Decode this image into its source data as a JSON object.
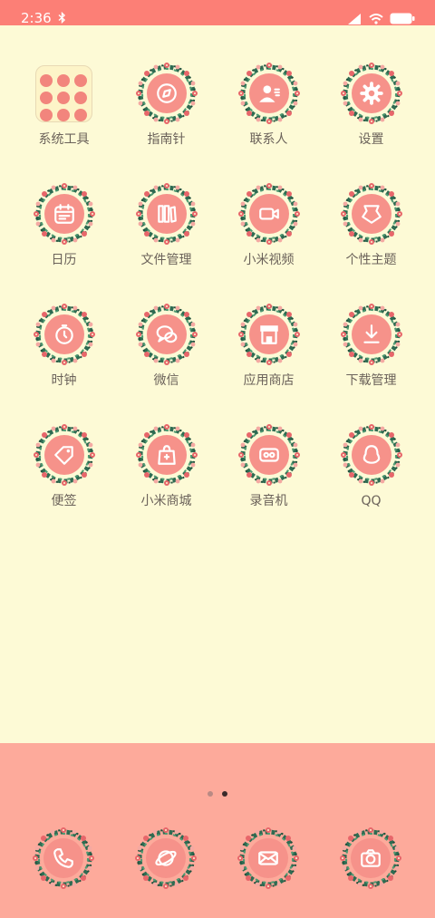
{
  "status_bar": {
    "time": "2:36",
    "bluetooth_icon": "bluetooth-icon",
    "signal_icon": "signal-icon",
    "wifi_icon": "wifi-icon",
    "battery_icon": "battery-icon"
  },
  "apps": [
    {
      "label": "系统工具",
      "icon": "folder-icon"
    },
    {
      "label": "指南针",
      "icon": "compass-icon"
    },
    {
      "label": "联系人",
      "icon": "contacts-icon"
    },
    {
      "label": "设置",
      "icon": "gear-icon"
    },
    {
      "label": "日历",
      "icon": "calendar-icon"
    },
    {
      "label": "文件管理",
      "icon": "file-manager-icon"
    },
    {
      "label": "小米视频",
      "icon": "video-icon"
    },
    {
      "label": "个性主题",
      "icon": "theme-icon"
    },
    {
      "label": "时钟",
      "icon": "clock-icon"
    },
    {
      "label": "微信",
      "icon": "wechat-icon"
    },
    {
      "label": "应用商店",
      "icon": "app-store-icon"
    },
    {
      "label": "下载管理",
      "icon": "download-icon"
    },
    {
      "label": "便签",
      "icon": "notes-icon"
    },
    {
      "label": "小米商城",
      "icon": "mi-store-icon"
    },
    {
      "label": "录音机",
      "icon": "recorder-icon"
    },
    {
      "label": "QQ",
      "icon": "qq-icon"
    }
  ],
  "page_indicator": {
    "pages": 2,
    "current": 2
  },
  "dock": [
    {
      "icon": "phone-icon"
    },
    {
      "icon": "browser-icon"
    },
    {
      "icon": "messages-icon"
    },
    {
      "icon": "camera-icon"
    }
  ],
  "colors": {
    "status_bar": "#fc7f76",
    "background": "#fdfad6",
    "dock": "#fdaa9b",
    "icon_circle": "#f6928a",
    "label": "#6b625a"
  }
}
